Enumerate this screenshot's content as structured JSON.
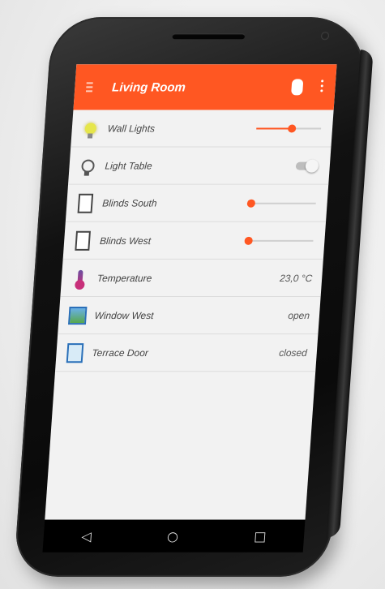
{
  "app": {
    "title": "Living Room"
  },
  "rows": [
    {
      "label": "Wall Lights",
      "control": "slider",
      "level": 0.55
    },
    {
      "label": "Light Table",
      "control": "toggle",
      "state": "off"
    },
    {
      "label": "Blinds South",
      "control": "slider",
      "level": 0.0
    },
    {
      "label": "Blinds West",
      "control": "slider",
      "level": 0.0
    },
    {
      "label": "Temperature",
      "value": "23,0 °C"
    },
    {
      "label": "Window West",
      "value": "open"
    },
    {
      "label": "Terrace Door",
      "value": "closed"
    }
  ],
  "nav": {
    "back": "◁",
    "home": "○",
    "recents": "□"
  },
  "colors": {
    "accent": "#ff5722"
  }
}
